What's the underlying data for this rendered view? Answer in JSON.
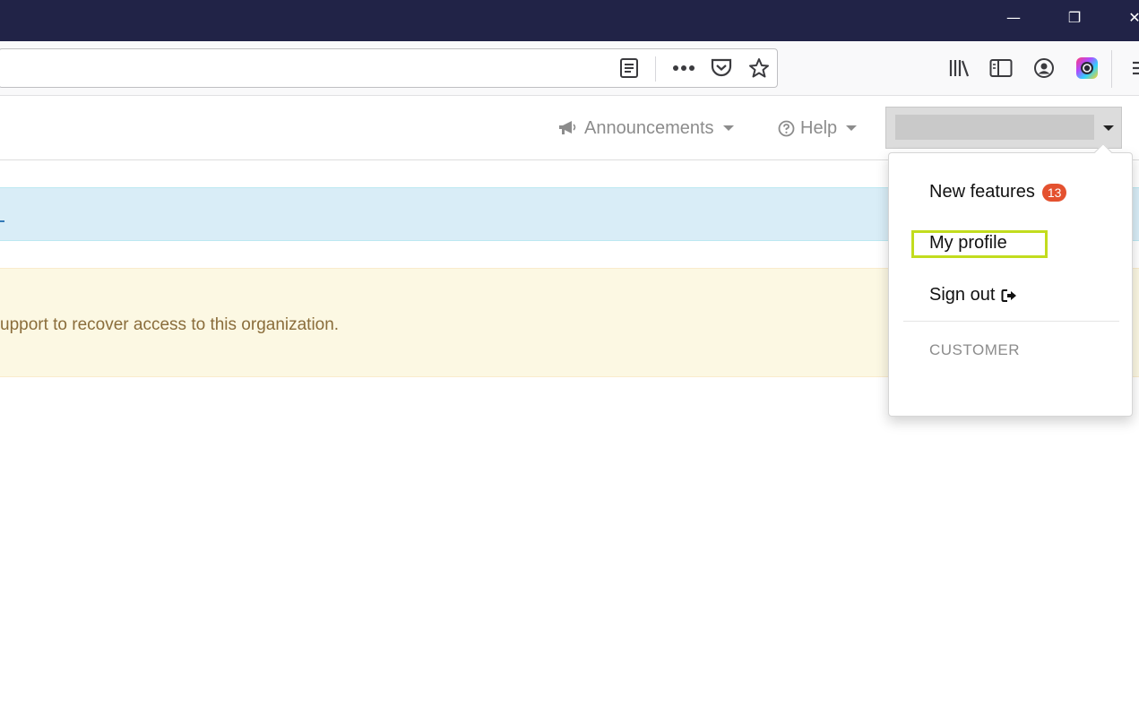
{
  "window": {
    "minimize_label": "—",
    "restore_label": "❐",
    "close_label": "✕"
  },
  "browser_toolbar": {
    "icons": [
      "reader-view-icon",
      "more-actions-icon",
      "pocket-icon",
      "bookmark-star-icon",
      "library-icon",
      "sidebar-icon",
      "account-icon",
      "extension-icon",
      "menu-icon"
    ]
  },
  "nav": {
    "announcements_label": "Announcements",
    "help_label": "Help"
  },
  "warning_banner": {
    "text": "upport to recover access to this organization."
  },
  "user_menu": {
    "new_features_label": "New features",
    "new_features_count": "13",
    "my_profile_label": "My profile",
    "sign_out_label": "Sign out",
    "section_header": "CUSTOMER"
  },
  "colors": {
    "titlebar": "#212347",
    "badge": "#e4512f",
    "highlight": "#c2dc1e",
    "info_banner": "#d9edf7",
    "warning_banner": "#fcf8e3"
  }
}
